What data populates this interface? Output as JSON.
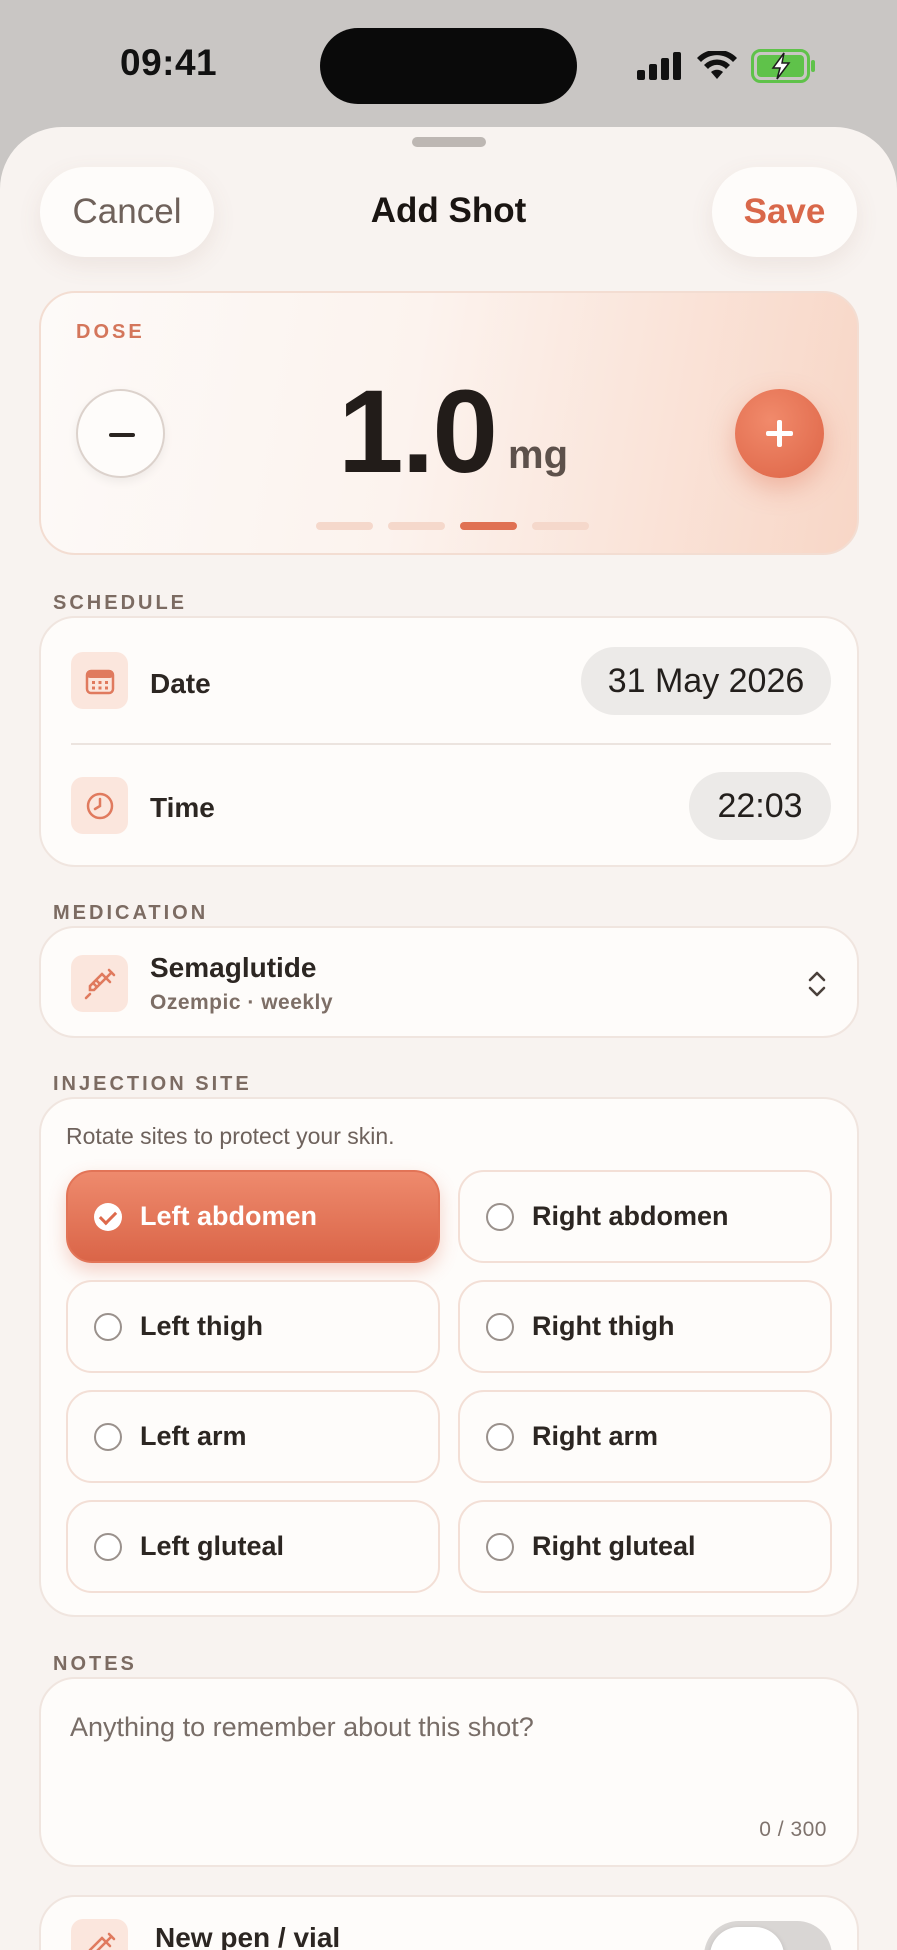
{
  "status_bar": {
    "time": "09:41"
  },
  "header": {
    "cancel_label": "Cancel",
    "title": "Add Shot",
    "save_label": "Save"
  },
  "dose": {
    "label": "DOSE",
    "value": "1.0",
    "unit": "mg",
    "step_index": 3,
    "step_count": 4
  },
  "schedule": {
    "section_label": "SCHEDULE",
    "date_label": "Date",
    "date_value": "31 May 2026",
    "time_label": "Time",
    "time_value": "22:03"
  },
  "medication": {
    "section_label": "MEDICATION",
    "name": "Semaglutide",
    "subtitle": "Ozempic · weekly"
  },
  "injection_site": {
    "section_label": "INJECTION SITE",
    "hint": "Rotate sites to protect your skin.",
    "options": [
      {
        "label": "Left abdomen",
        "selected": true
      },
      {
        "label": "Right abdomen",
        "selected": false
      },
      {
        "label": "Left thigh",
        "selected": false
      },
      {
        "label": "Right thigh",
        "selected": false
      },
      {
        "label": "Left arm",
        "selected": false
      },
      {
        "label": "Right arm",
        "selected": false
      },
      {
        "label": "Left gluteal",
        "selected": false
      },
      {
        "label": "Right gluteal",
        "selected": false
      }
    ]
  },
  "notes": {
    "section_label": "NOTES",
    "placeholder": "Anything to remember about this shot?",
    "counter": "0 / 300"
  },
  "new_pen": {
    "label": "New pen / vial",
    "enabled": false
  },
  "colors": {
    "accent": "#de6a4c",
    "background": "#f8f3f0",
    "card": "#fefcfa"
  },
  "icons": {
    "cellular": "cellular-signal-icon",
    "wifi": "wifi-icon",
    "battery": "battery-charging-icon",
    "calendar": "calendar-icon",
    "clock": "clock-icon",
    "syringe": "syringe-icon",
    "chevron": "chevron-up-down-icon"
  }
}
